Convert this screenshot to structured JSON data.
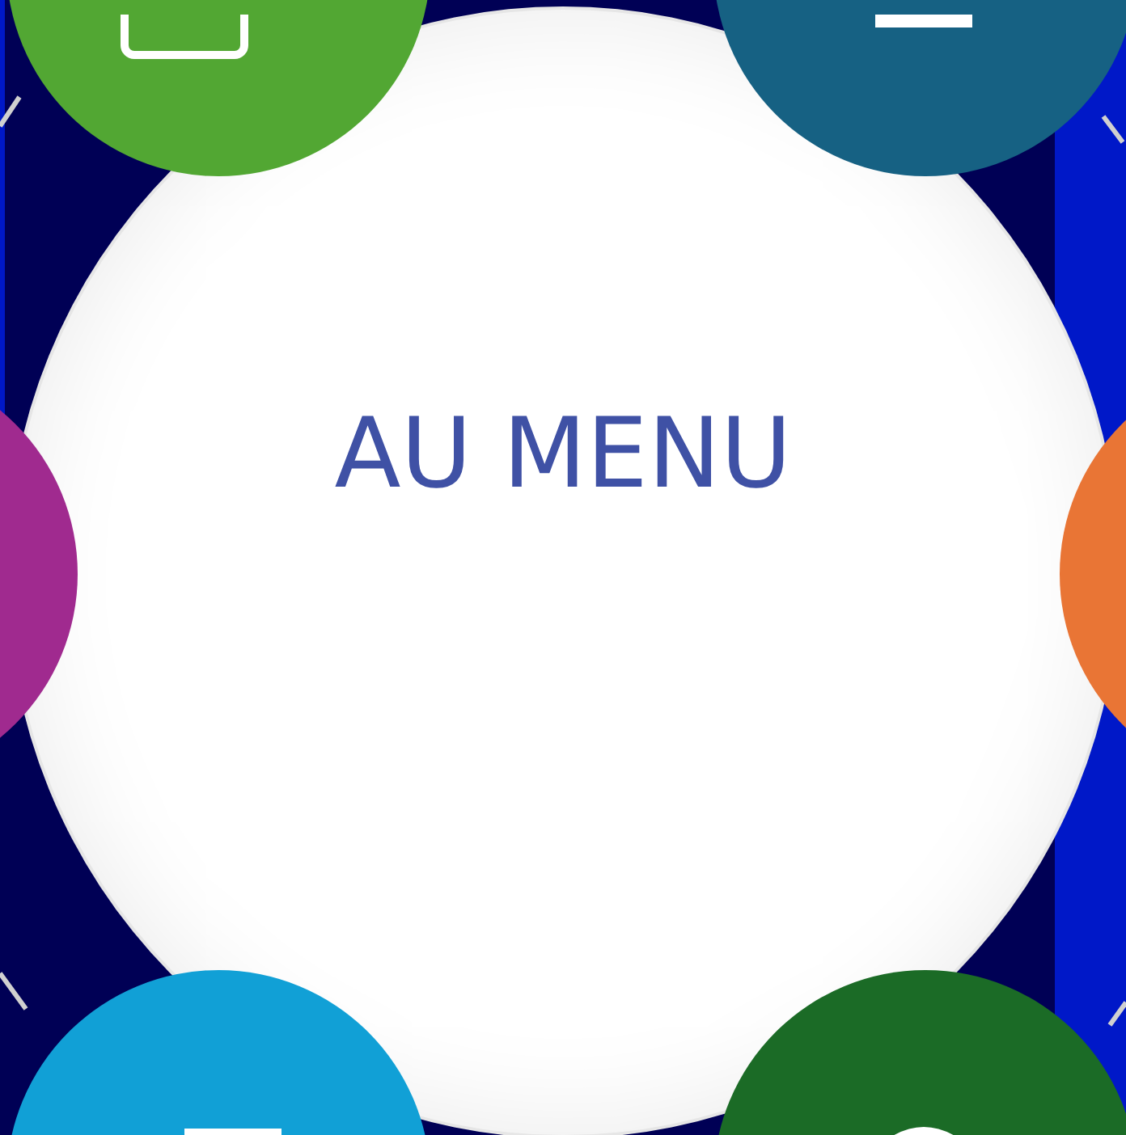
{
  "title": "AU MENU",
  "items": [
    {
      "color": "#52a733",
      "kind": "frame"
    },
    {
      "color": "#166183",
      "kind": "bar"
    },
    {
      "color": "#a02a8f",
      "kind": "none"
    },
    {
      "color": "#e97535",
      "kind": "none"
    },
    {
      "color": "#11a0d6",
      "kind": "bar"
    },
    {
      "color": "#1b6b26",
      "kind": "dome"
    }
  ]
}
